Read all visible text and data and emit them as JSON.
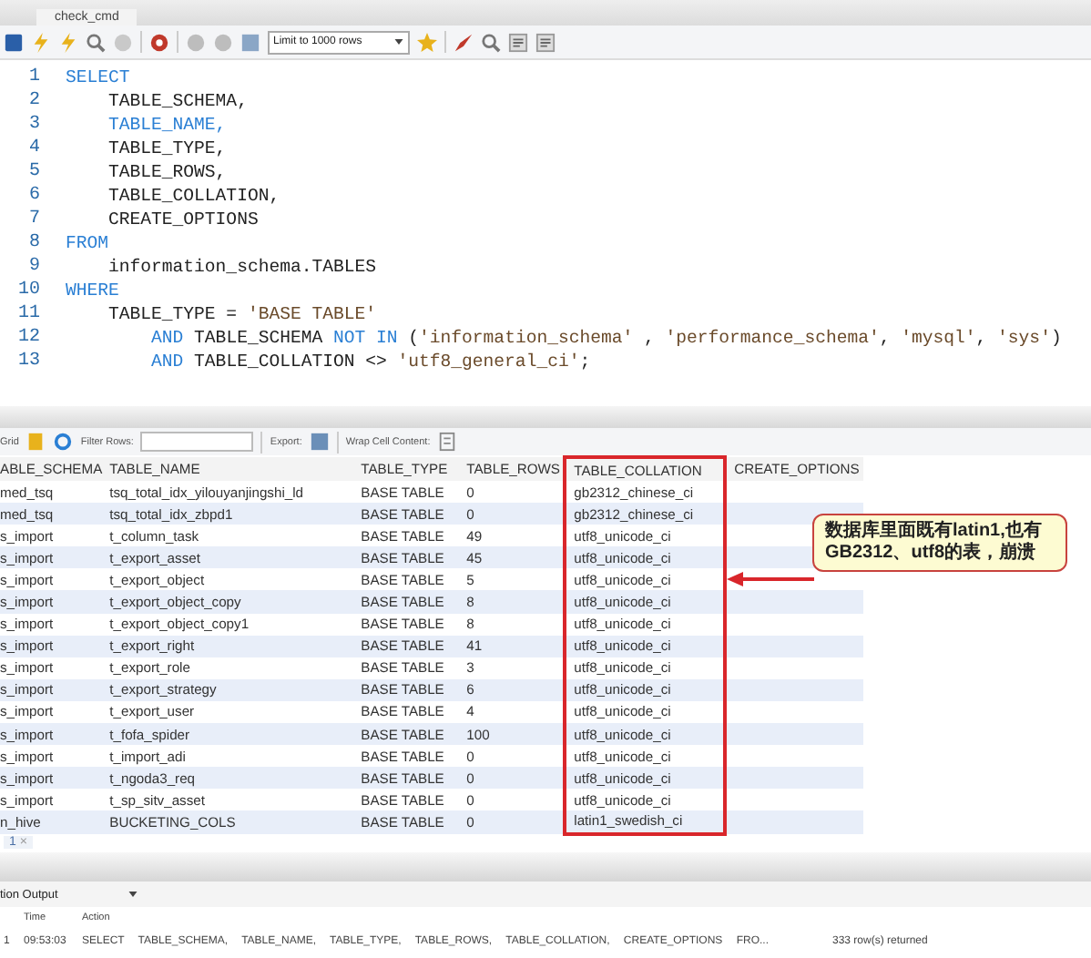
{
  "document_tab": {
    "title": "check_cmd"
  },
  "toolbar": {
    "limit_select": "Limit to 1000 rows"
  },
  "editor": {
    "lines": [
      {
        "number": "1",
        "tokens": [
          {
            "kind": "keyword",
            "text": "SELECT"
          }
        ]
      },
      {
        "number": "2",
        "tokens": [
          {
            "kind": "plain",
            "text": "    TABLE_SCHEMA,"
          }
        ]
      },
      {
        "number": "3",
        "tokens": [
          {
            "kind": "keyword",
            "text": "    TABLE_NAME,"
          }
        ]
      },
      {
        "number": "4",
        "tokens": [
          {
            "kind": "plain",
            "text": "    TABLE_TYPE,"
          }
        ]
      },
      {
        "number": "5",
        "tokens": [
          {
            "kind": "plain",
            "text": "    TABLE_ROWS,"
          }
        ]
      },
      {
        "number": "6",
        "tokens": [
          {
            "kind": "plain",
            "text": "    TABLE_COLLATION,"
          }
        ]
      },
      {
        "number": "7",
        "tokens": [
          {
            "kind": "plain",
            "text": "    CREATE_OPTIONS"
          }
        ]
      },
      {
        "number": "8",
        "tokens": [
          {
            "kind": "keyword",
            "text": "FROM"
          }
        ]
      },
      {
        "number": "9",
        "tokens": [
          {
            "kind": "plain",
            "text": "    information_schema.TABLES"
          }
        ]
      },
      {
        "number": "10",
        "tokens": [
          {
            "kind": "keyword",
            "text": "WHERE"
          }
        ]
      },
      {
        "number": "11",
        "tokens": [
          {
            "kind": "plain",
            "text": "    TABLE_TYPE = "
          },
          {
            "kind": "string",
            "text": "'BASE TABLE'"
          }
        ]
      },
      {
        "number": "12",
        "tokens": [
          {
            "kind": "keyword",
            "text": "        AND"
          },
          {
            "kind": "plain",
            "text": " TABLE_SCHEMA "
          },
          {
            "kind": "keyword",
            "text": "NOT IN"
          },
          {
            "kind": "plain",
            "text": " ("
          },
          {
            "kind": "string",
            "text": "'information_schema'"
          },
          {
            "kind": "plain",
            "text": " , "
          },
          {
            "kind": "string",
            "text": "'performance_schema'"
          },
          {
            "kind": "plain",
            "text": ", "
          },
          {
            "kind": "string",
            "text": "'mysql'"
          },
          {
            "kind": "plain",
            "text": ", "
          },
          {
            "kind": "string",
            "text": "'sys'"
          },
          {
            "kind": "plain",
            "text": ")"
          }
        ]
      },
      {
        "number": "13",
        "tokens": [
          {
            "kind": "keyword",
            "text": "        AND"
          },
          {
            "kind": "plain",
            "text": " TABLE_COLLATION <> "
          },
          {
            "kind": "string",
            "text": "'utf8_general_ci'"
          },
          {
            "kind": "plain",
            "text": ";"
          }
        ]
      }
    ]
  },
  "results_toolbar": {
    "view_label": "Grid",
    "filter_label": "Filter Rows:",
    "export_label": "Export:",
    "wrap_label": "Wrap Cell Content:"
  },
  "grid": {
    "columns": [
      {
        "label": "ABLE_SCHEMA",
        "highlighted": false
      },
      {
        "label": "TABLE_NAME",
        "highlighted": false
      },
      {
        "label": "TABLE_TYPE",
        "highlighted": false
      },
      {
        "label": "TABLE_ROWS",
        "highlighted": false
      },
      {
        "label": "TABLE_COLLATION",
        "highlighted": true
      },
      {
        "label": "CREATE_OPTIONS",
        "highlighted": false
      }
    ],
    "rows": [
      [
        "med_tsq",
        "tsq_total_idx_yilouyanjingshi_ld",
        "BASE TABLE",
        "0",
        "gb2312_chinese_ci",
        ""
      ],
      [
        "med_tsq",
        "tsq_total_idx_zbpd1",
        "BASE TABLE",
        "0",
        "gb2312_chinese_ci",
        ""
      ],
      [
        "s_import",
        "t_column_task",
        "BASE TABLE",
        "49",
        "utf8_unicode_ci",
        ""
      ],
      [
        "s_import",
        "t_export_asset",
        "BASE TABLE",
        "45",
        "utf8_unicode_ci",
        ""
      ],
      [
        "s_import",
        "t_export_object",
        "BASE TABLE",
        "5",
        "utf8_unicode_ci",
        ""
      ],
      [
        "s_import",
        "t_export_object_copy",
        "BASE TABLE",
        "8",
        "utf8_unicode_ci",
        ""
      ],
      [
        "s_import",
        "t_export_object_copy1",
        "BASE TABLE",
        "8",
        "utf8_unicode_ci",
        ""
      ],
      [
        "s_import",
        "t_export_right",
        "BASE TABLE",
        "41",
        "utf8_unicode_ci",
        ""
      ],
      [
        "s_import",
        "t_export_role",
        "BASE TABLE",
        "3",
        "utf8_unicode_ci",
        ""
      ],
      [
        "s_import",
        "t_export_strategy",
        "BASE TABLE",
        "6",
        "utf8_unicode_ci",
        ""
      ],
      [
        "s_import",
        "t_export_user",
        "BASE TABLE",
        "4",
        "utf8_unicode_ci",
        ""
      ],
      [
        "s_import",
        "t_fofa_spider",
        "BASE TABLE",
        "100",
        "utf8_unicode_ci",
        ""
      ],
      [
        "s_import",
        "t_import_adi",
        "BASE TABLE",
        "0",
        "utf8_unicode_ci",
        ""
      ],
      [
        "s_import",
        "t_ngoda3_req",
        "BASE TABLE",
        "0",
        "utf8_unicode_ci",
        ""
      ],
      [
        "s_import",
        "t_sp_sitv_asset",
        "BASE TABLE",
        "0",
        "utf8_unicode_ci",
        ""
      ],
      [
        "n_hive",
        "BUCKETING_COLS",
        "BASE TABLE",
        "0",
        "latin1_swedish_ci",
        ""
      ]
    ]
  },
  "callout": {
    "text": "数据库里面既有latin1,也有GB2312、utf8的表，崩溃"
  },
  "result_tabs": [
    {
      "label": "1",
      "close": "×",
      "selected": true
    }
  ],
  "output": {
    "selector": "tion Output",
    "columns": [
      "Time",
      "Action"
    ],
    "rows": [
      {
        "number": "1",
        "time": "09:53:03",
        "action": "SELECT TABLE_SCHEMA, TABLE_NAME, TABLE_TYPE, TABLE_ROWS, TABLE_COLLATION, CREATE_OPTIONS FRO...",
        "message": "333 row(s) returned"
      }
    ]
  }
}
